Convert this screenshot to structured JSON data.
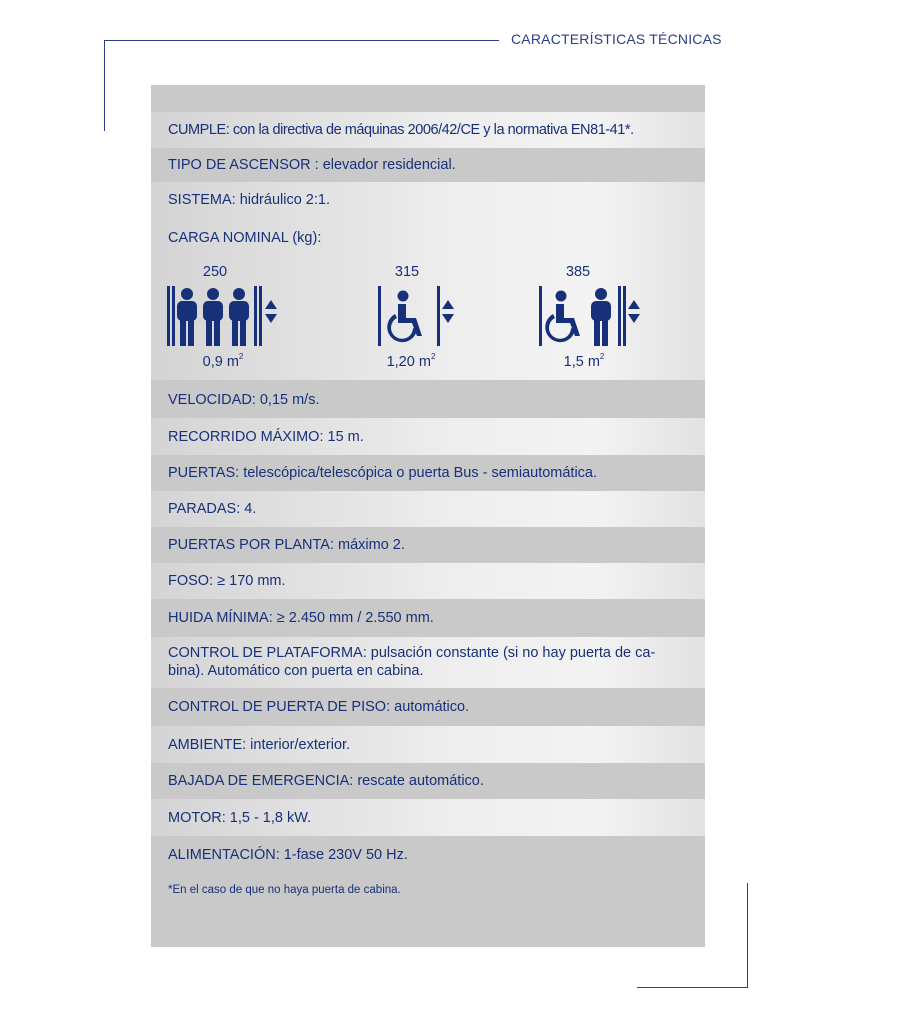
{
  "header": {
    "title": "CARACTERÍSTICAS TÉCNICAS"
  },
  "rows_top": [
    {
      "text": "CUMPLE: con la directiva de máquinas 2006/42/CE y la normativa EN81-41*."
    },
    {
      "text": "TIPO DE ASCENSOR : elevador residencial."
    },
    {
      "text": "SISTEMA: hidráulico 2:1."
    }
  ],
  "carga": {
    "label": "CARGA NOMINAL (kg):",
    "options": [
      {
        "load": "250",
        "area": "0,9 m",
        "sup": "2",
        "icon": "three-persons-icon"
      },
      {
        "load": "315",
        "area": "1,20 m",
        "sup": "2",
        "icon": "wheelchair-icon"
      },
      {
        "load": "385",
        "area": "1,5 m",
        "sup": "2",
        "icon": "wheelchair-and-person-icon"
      }
    ]
  },
  "rows_bottom": [
    {
      "text": "VELOCIDAD: 0,15 m/s."
    },
    {
      "text": "RECORRIDO MÁXIMO: 15 m."
    },
    {
      "text": "PUERTAS: telescópica/telescópica o puerta Bus - semiautomática."
    },
    {
      "text": "PARADAS: 4."
    },
    {
      "text": "PUERTAS POR PLANTA: máximo 2."
    },
    {
      "text": "FOSO: ≥ 170 mm."
    },
    {
      "text": "HUIDA MÍNIMA: ≥ 2.450 mm / 2.550 mm."
    },
    {
      "text": "CONTROL DE PLATAFORMA: pulsación constante (si no hay puerta de ca- bina). Automático con puerta en cabina."
    },
    {
      "text": "CONTROL DE PUERTA DE PISO: automático."
    },
    {
      "text": "AMBIENTE: interior/exterior."
    },
    {
      "text": "BAJADA DE EMERGENCIA: rescate automático."
    },
    {
      "text": "MOTOR: 1,5 - 1,8 kW."
    },
    {
      "text": "ALIMENTACIÓN: 1-fase 230V 50 Hz."
    }
  ],
  "footnote": "*En el caso de que no haya puerta de cabina.",
  "colors": {
    "text": "#17307a",
    "panel": "#c9c9c9",
    "band_light": "#eeeeee",
    "line": "#2a3f86"
  }
}
